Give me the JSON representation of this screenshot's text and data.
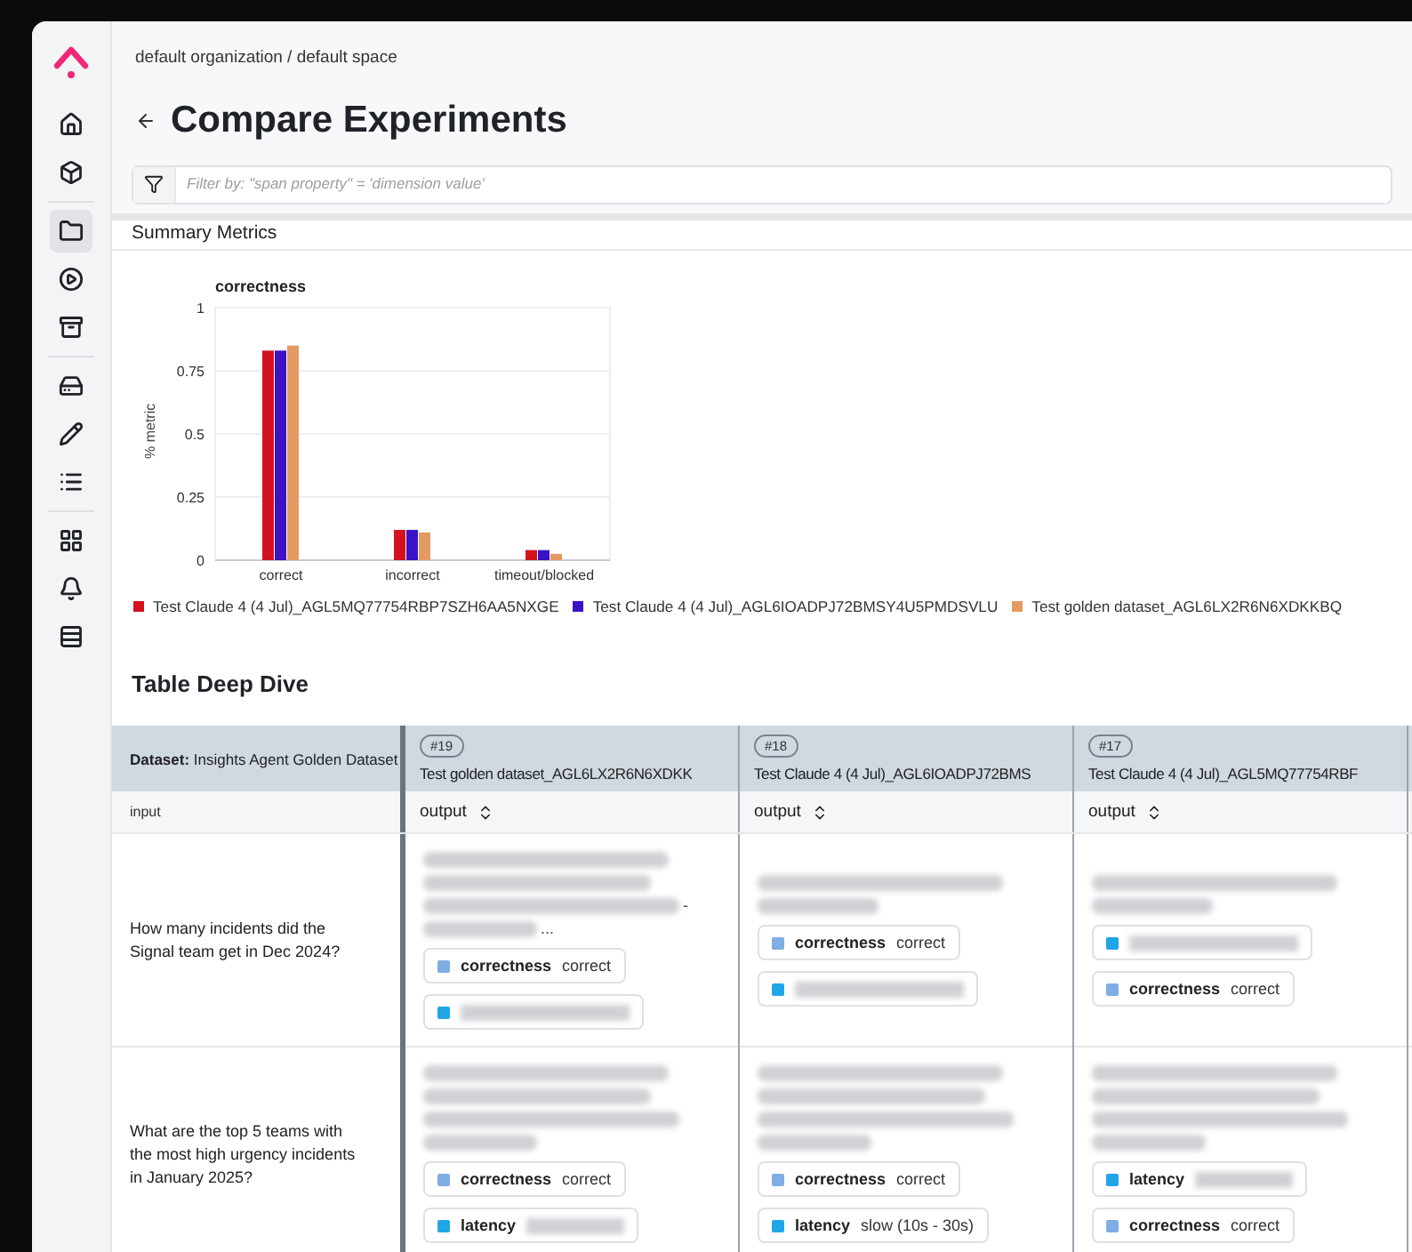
{
  "sidebar": {
    "groups": [
      [
        {
          "selected": false
        },
        {
          "selected": false
        }
      ],
      [
        {
          "selected": true
        },
        {
          "selected": false
        },
        {
          "selected": false
        }
      ],
      [
        {
          "selected": false
        },
        {
          "selected": false
        },
        {
          "selected": false
        }
      ],
      [
        {
          "selected": false
        },
        {
          "selected": false
        },
        {
          "selected": false
        }
      ]
    ]
  },
  "breadcrumb": "default organization / default space",
  "title": "Compare Experiments",
  "filter": {
    "placeholder": "Filter by: \"span property\" = 'dimension value'"
  },
  "summary": {
    "title": "Summary Metrics",
    "chart_data": {
      "type": "bar",
      "title": "correctness",
      "ylabel": "% metric",
      "categories": [
        "correct",
        "incorrect",
        "timeout/blocked"
      ],
      "ylim": [
        0,
        1
      ],
      "grid": true,
      "yticks": [
        0,
        0.25,
        0.5,
        0.75,
        1
      ],
      "series": [
        {
          "name": "Test Claude 4 (4 Jul)_AGL5MQ77754RBP7SZH6AA5NXGE",
          "color": "#d4121e",
          "values": [
            0.83,
            0.12,
            0.04
          ]
        },
        {
          "name": "Test Claude 4 (4 Jul)_AGL6IOADPJ72BMSY4U5PMDSVLU",
          "color": "#3b13c4",
          "values": [
            0.83,
            0.12,
            0.04
          ]
        },
        {
          "name": "Test golden dataset_AGL6LX2R6N6XDKKBQ",
          "color": "#e39a62",
          "values": [
            0.85,
            0.11,
            0.025
          ]
        }
      ]
    }
  },
  "table": {
    "title": "Table Deep Dive",
    "dataset_label": "Dataset:",
    "dataset_name": "Insights Agent Golden Dataset",
    "input_header": "input",
    "columns": [
      {
        "badge": "#19",
        "name": "Test golden dataset_AGL6LX2R6N6XDKK",
        "subheader": "output"
      },
      {
        "badge": "#18",
        "name": "Test Claude 4 (4 Jul)_AGL6IOADPJ72BMS",
        "subheader": "output"
      },
      {
        "badge": "#17",
        "name": "Test Claude 4 (4 Jul)_AGL5MQ77754RBF",
        "subheader": "output"
      }
    ],
    "rows": [
      {
        "input": "How many incidents did the Signal team get in Dec 2024?",
        "cells": [
          {
            "lines": [
              {
                "kind": "redacted"
              },
              {
                "kind": "redacted"
              },
              {
                "kind": "redacted",
                "suffix": "-"
              },
              {
                "kind": "short",
                "suffix": "..."
              }
            ],
            "tags": [
              {
                "name": "correctness",
                "value": "correct",
                "color": "#7eaee3",
                "redacted": false
              },
              {
                "color": "#20a6e6",
                "redacted": true
              }
            ]
          },
          {
            "lines": [
              {
                "kind": "redacted"
              },
              {
                "kind": "short"
              }
            ],
            "tags": [
              {
                "name": "correctness",
                "value": "correct",
                "color": "#7eaee3",
                "redacted": false
              },
              {
                "color": "#20a6e6",
                "redacted": true
              }
            ]
          },
          {
            "lines": [
              {
                "kind": "redacted"
              },
              {
                "kind": "short"
              }
            ],
            "tags": [
              {
                "color": "#20a6e6",
                "redacted": true
              },
              {
                "name": "correctness",
                "value": "correct",
                "color": "#7eaee3",
                "redacted": false
              }
            ]
          }
        ]
      },
      {
        "input": "What are the top 5 teams with the most high urgency incidents in January 2025?",
        "cells": [
          {
            "lines": [
              {
                "kind": "redacted"
              },
              {
                "kind": "redacted"
              },
              {
                "kind": "redacted"
              },
              {
                "kind": "short"
              }
            ],
            "tags": [
              {
                "name": "correctness",
                "value": "correct",
                "color": "#7eaee3",
                "redacted": false
              },
              {
                "name": "latency",
                "color": "#20a6e6",
                "redacted": true
              }
            ]
          },
          {
            "lines": [
              {
                "kind": "redacted"
              },
              {
                "kind": "redacted"
              },
              {
                "kind": "redacted"
              },
              {
                "kind": "short"
              }
            ],
            "tags": [
              {
                "name": "correctness",
                "value": "correct",
                "color": "#7eaee3",
                "redacted": false
              },
              {
                "name": "latency",
                "value": "slow (10s - 30s)",
                "color": "#20a6e6",
                "redacted": false
              }
            ]
          },
          {
            "lines": [
              {
                "kind": "redacted"
              },
              {
                "kind": "redacted"
              },
              {
                "kind": "redacted"
              },
              {
                "kind": "short"
              }
            ],
            "tags": [
              {
                "name": "latency",
                "color": "#20a6e6",
                "redacted": true
              },
              {
                "name": "correctness",
                "value": "correct",
                "color": "#7eaee3",
                "redacted": false
              }
            ]
          }
        ]
      }
    ]
  }
}
